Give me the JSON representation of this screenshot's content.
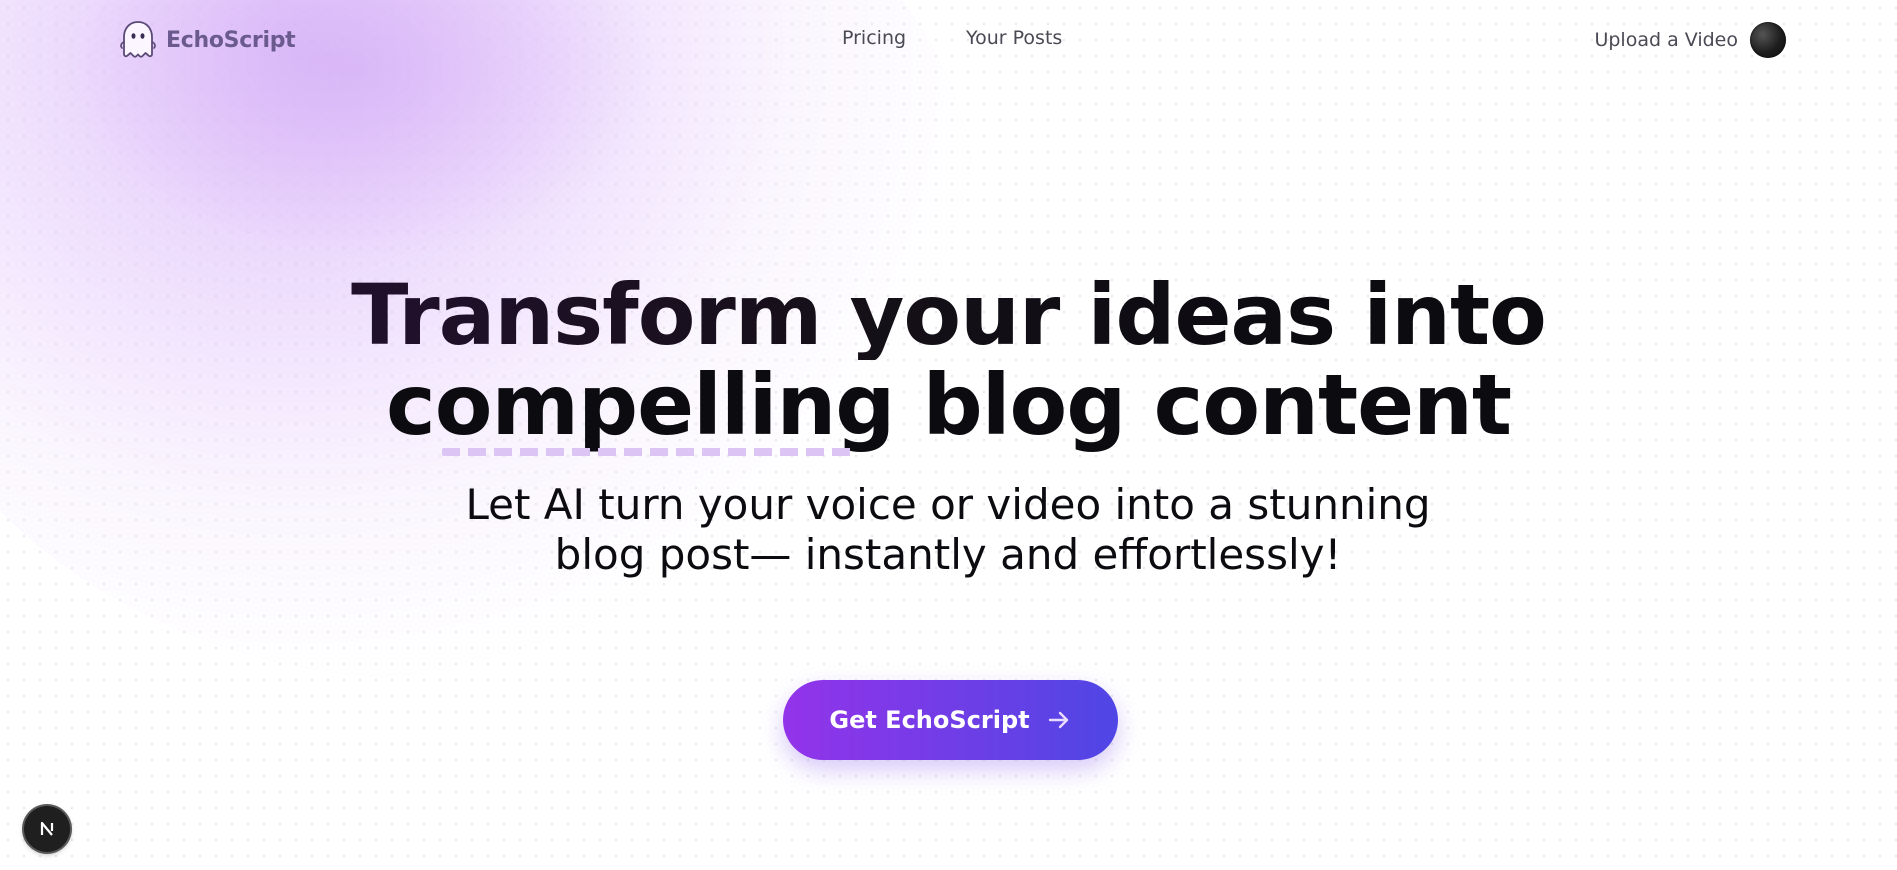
{
  "header": {
    "brand": "EchoScript",
    "logo_icon": "ghost-icon",
    "nav": [
      {
        "label": "Pricing"
      },
      {
        "label": "Your Posts"
      }
    ],
    "upload_label": "Upload a Video",
    "avatar_icon": "user-avatar"
  },
  "hero": {
    "title_line1": "Transform your ideas into",
    "title_line2": "compelling blog content",
    "subtitle": "Let AI turn your voice or video into a stunning blog post— instantly and effortlessly!",
    "cta_label": "Get EchoScript",
    "cta_icon": "arrow-right-icon"
  },
  "dev_badge": {
    "icon": "nextjs-icon"
  },
  "colors": {
    "accent_start": "#9333ea",
    "accent_end": "#4f46e5",
    "brand_text": "#6b5a8e",
    "glow": "#d6b4f7"
  }
}
